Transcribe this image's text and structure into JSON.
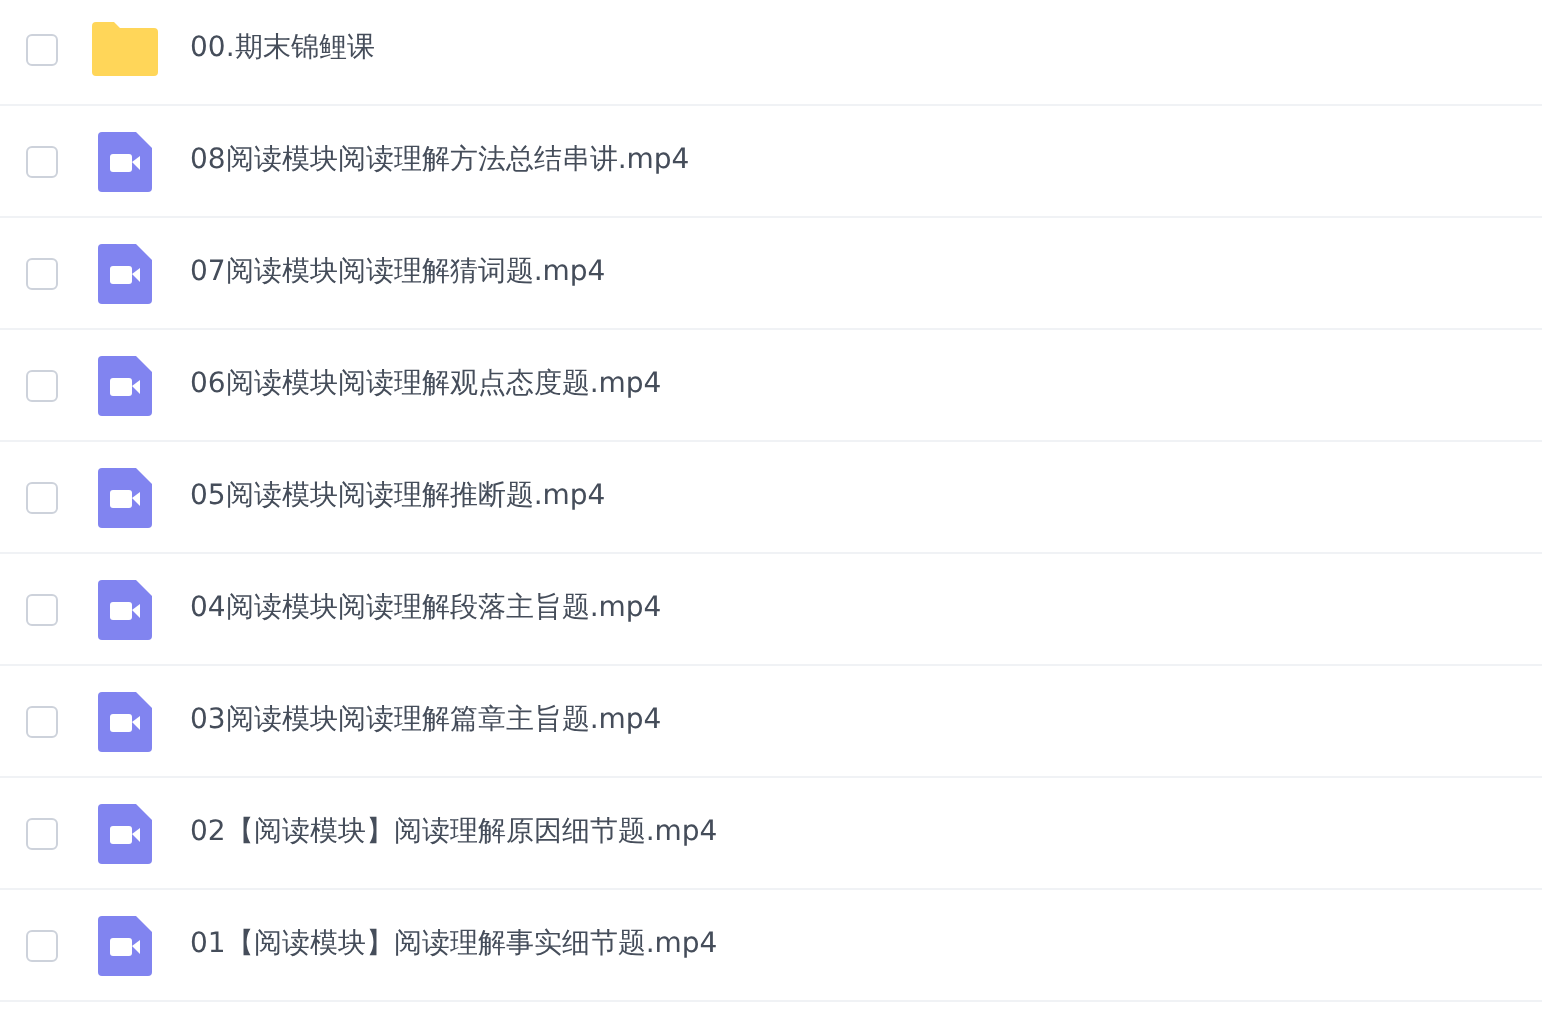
{
  "files": [
    {
      "kind": "folder",
      "name": "00.期末锦鲤课",
      "checked": false
    },
    {
      "kind": "video",
      "name": "08阅读模块阅读理解方法总结串讲.mp4",
      "checked": false
    },
    {
      "kind": "video",
      "name": "07阅读模块阅读理解猜词题.mp4",
      "checked": false
    },
    {
      "kind": "video",
      "name": "06阅读模块阅读理解观点态度题.mp4",
      "checked": false
    },
    {
      "kind": "video",
      "name": "05阅读模块阅读理解推断题.mp4",
      "checked": false
    },
    {
      "kind": "video",
      "name": "04阅读模块阅读理解段落主旨题.mp4",
      "checked": false
    },
    {
      "kind": "video",
      "name": "03阅读模块阅读理解篇章主旨题.mp4",
      "checked": false
    },
    {
      "kind": "video",
      "name": "02【阅读模块】阅读理解原因细节题.mp4",
      "checked": false
    },
    {
      "kind": "video",
      "name": "01【阅读模块】阅读理解事实细节题.mp4",
      "checked": false
    }
  ]
}
